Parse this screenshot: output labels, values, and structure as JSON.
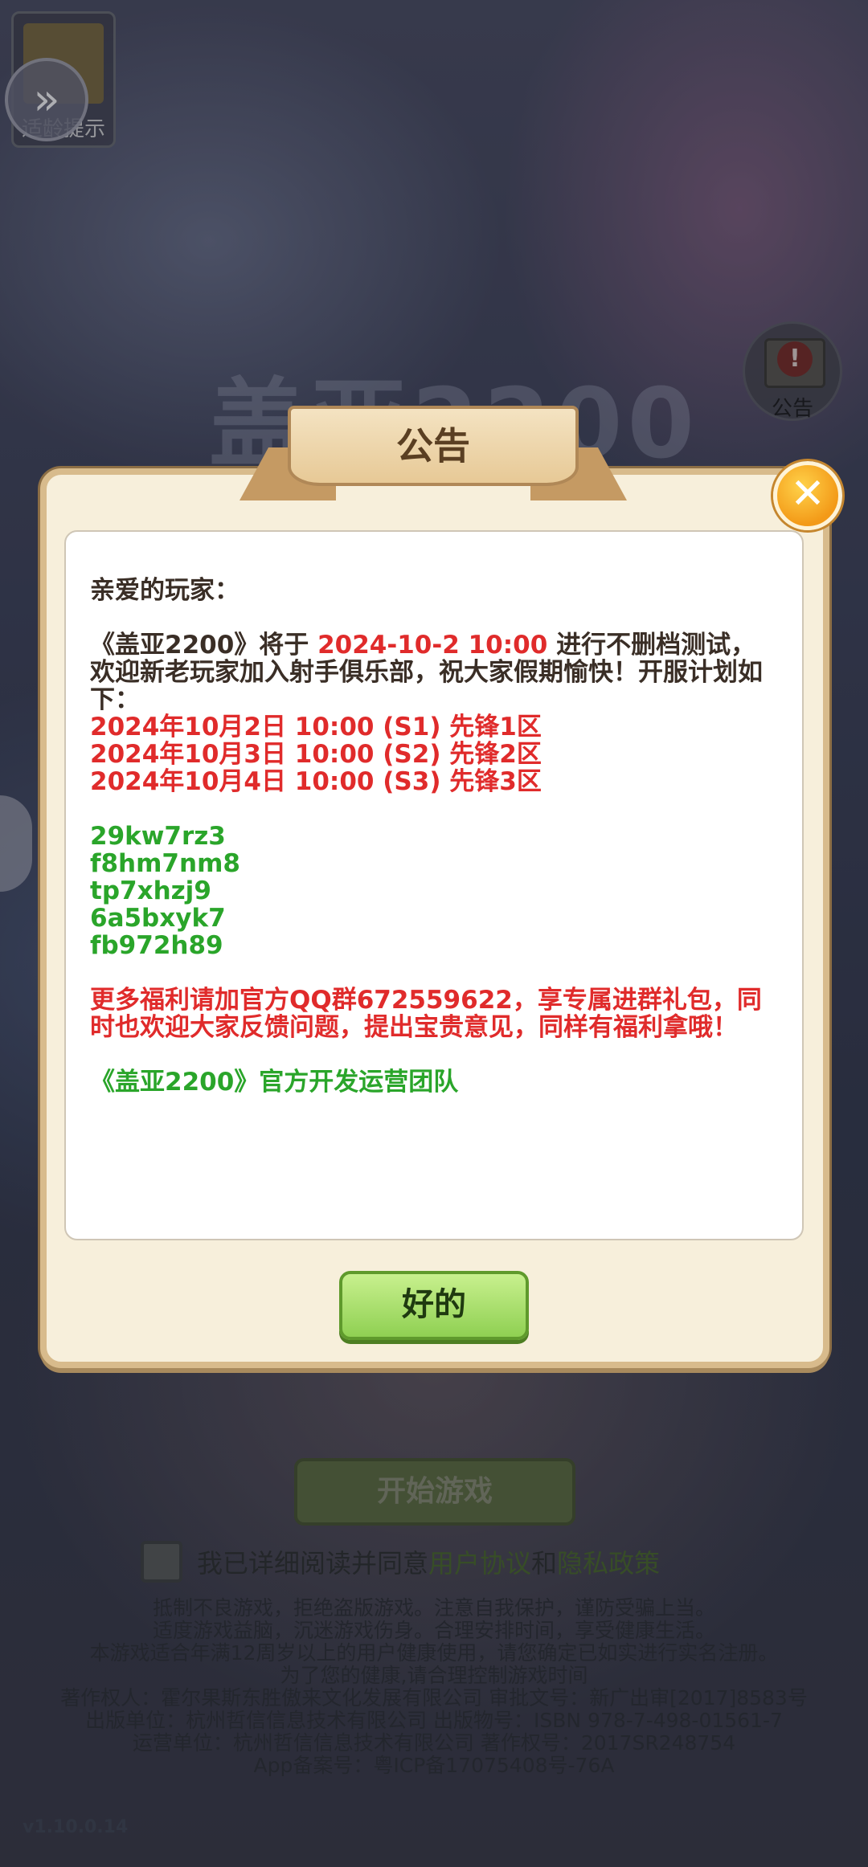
{
  "background": {
    "age_badge_label": "适龄提示",
    "notice_label": "公告",
    "logo_text": "盖亚2200",
    "start_button": "开始游戏",
    "agree_text": "我已详细阅读并同意",
    "agree_link_user": "用户协议",
    "agree_and": "和",
    "agree_link_privacy": "隐私政策",
    "legal_lines": [
      "抵制不良游戏，拒绝盗版游戏。注意自我保护，谨防受骗上当。",
      "适度游戏益脑，沉迷游戏伤身。合理安排时间，享受健康生活。",
      "本游戏适合年满12周岁以上的用户健康使用，请您确定已如实进行实名注册。",
      "为了您的健康,请合理控制游戏时间",
      "著作权人：霍尔果斯东胜傲来文化发展有限公司 审批文号：新广出审[2017]8583号",
      "出版单位：杭州哲信信息技术有限公司 出版物号：ISBN 978-7-498-01561-7",
      "运营单位：杭州哲信信息技术有限公司 著作权号：2017SR248754",
      "App备案号：粤ICP备17075408号-76A"
    ],
    "version": "v1.10.0.14"
  },
  "modal": {
    "title": "公告",
    "greeting": "亲爱的玩家：",
    "intro_before": "《盖亚2200》将于 ",
    "intro_date": "2024-10-2 10:00",
    "intro_after": " 进行不删档测试，欢迎新老玩家加入射手俱乐部，祝大家假期愉快！开服计划如下：",
    "schedule": [
      "2024年10月2日 10:00  (S1) 先锋1区",
      "2024年10月3日 10:00  (S2) 先锋2区",
      "2024年10月4日 10:00  (S3) 先锋3区"
    ],
    "codes": [
      "29kw7rz3",
      "f8hm7nm8",
      "tp7xhzj9",
      "6a5bxyk7",
      "fb972h89"
    ],
    "welfare": "更多福利请加官方QQ群672559622，享专属进群礼包，同时也欢迎大家反馈问题，提出宝贵意见，同样有福利拿哦！",
    "signature": "《盖亚2200》官方开发运营团队",
    "ok_button": "好的"
  },
  "colors": {
    "highlight_red": "#e02b2b",
    "code_green": "#2aa52a",
    "ok_green": "#8fd052",
    "panel_border": "#d8bb8c"
  },
  "icons": [
    "double-chevron-right-icon",
    "close-icon",
    "alert-board-icon"
  ]
}
